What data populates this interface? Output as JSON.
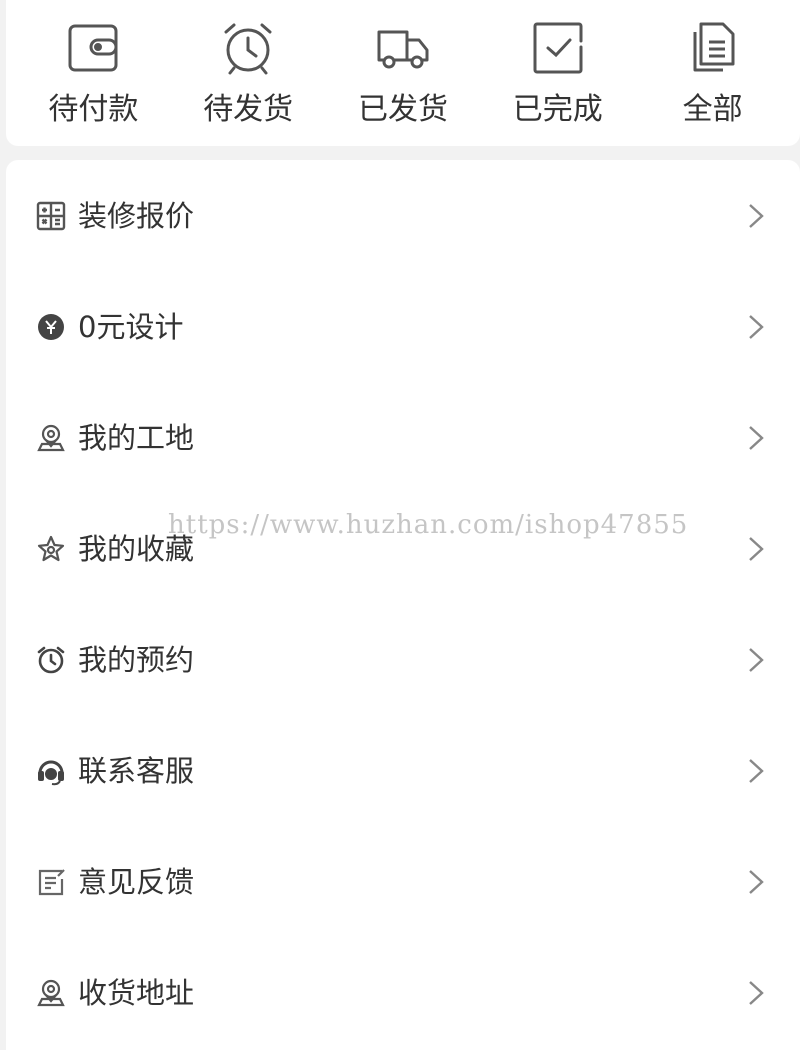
{
  "orders": [
    {
      "label": "待付款",
      "icon": "wallet-icon"
    },
    {
      "label": "待发货",
      "icon": "alarm-clock-icon"
    },
    {
      "label": "已发货",
      "icon": "truck-icon"
    },
    {
      "label": "已完成",
      "icon": "clipboard-check-icon"
    },
    {
      "label": "全部",
      "icon": "documents-icon"
    }
  ],
  "menu": [
    {
      "label": "装修报价",
      "icon": "calculator-icon"
    },
    {
      "label": "0元设计",
      "icon": "yen-coin-icon"
    },
    {
      "label": "我的工地",
      "icon": "location-pin-icon"
    },
    {
      "label": "我的收藏",
      "icon": "star-icon"
    },
    {
      "label": "我的预约",
      "icon": "alarm-clock-icon"
    },
    {
      "label": "联系客服",
      "icon": "headset-icon"
    },
    {
      "label": "意见反馈",
      "icon": "edit-note-icon"
    },
    {
      "label": "收货地址",
      "icon": "location-pin-icon"
    }
  ],
  "watermark": "https://www.huzhan.com/ishop47855",
  "colors": {
    "icon": "#555555",
    "text": "#333333",
    "chevron": "#888888",
    "background": "#f2f2f2"
  }
}
